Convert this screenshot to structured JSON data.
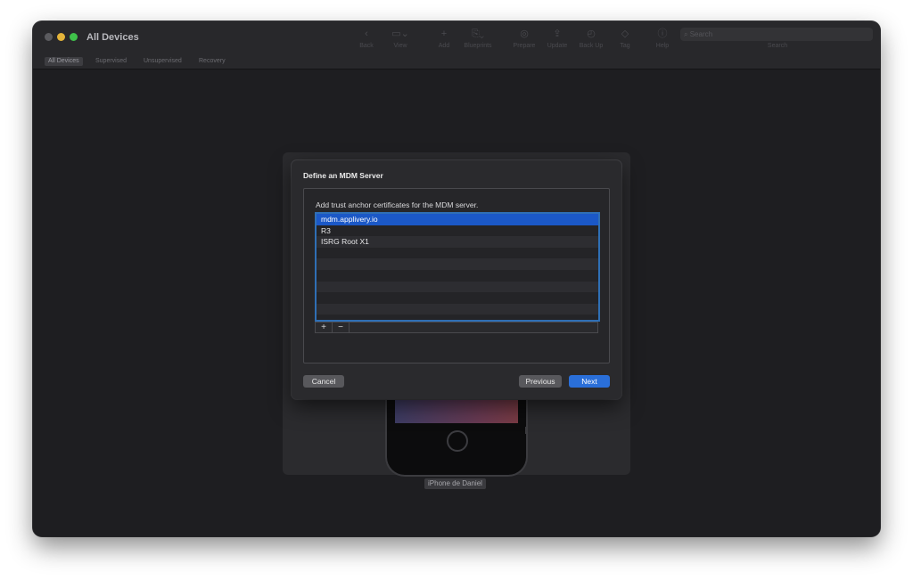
{
  "window": {
    "title": "All Devices"
  },
  "toolbar": {
    "items": [
      {
        "label": "Back",
        "icon": "chevron-left"
      },
      {
        "label": "View",
        "icon": "view-rectangle"
      },
      {
        "label": "Add",
        "icon": "plus"
      },
      {
        "label": "Blueprints",
        "icon": "blueprints"
      },
      {
        "label": "Prepare",
        "icon": "prepare"
      },
      {
        "label": "Update",
        "icon": "update"
      },
      {
        "label": "Back Up",
        "icon": "backup"
      },
      {
        "label": "Tag",
        "icon": "tag"
      },
      {
        "label": "Help",
        "icon": "help"
      }
    ],
    "search_placeholder": "Search",
    "search_label": "Search"
  },
  "segments": [
    {
      "label": "All Devices",
      "active": true
    },
    {
      "label": "Supervised",
      "active": false
    },
    {
      "label": "Unsupervised",
      "active": false
    },
    {
      "label": "Recovery",
      "active": false
    }
  ],
  "device": {
    "name": "iPhone de Daniel"
  },
  "sheet": {
    "title": "Define an MDM Server",
    "instruction": "Add trust anchor certificates for the MDM server.",
    "certificates": [
      "mdm.applivery.io",
      "R3",
      "ISRG Root X1"
    ],
    "selected_index": 0,
    "add_symbol": "+",
    "remove_symbol": "−",
    "cancel_label": "Cancel",
    "previous_label": "Previous",
    "next_label": "Next"
  },
  "colors": {
    "accent": "#2a6fd9",
    "selection": "#1b58c7"
  }
}
